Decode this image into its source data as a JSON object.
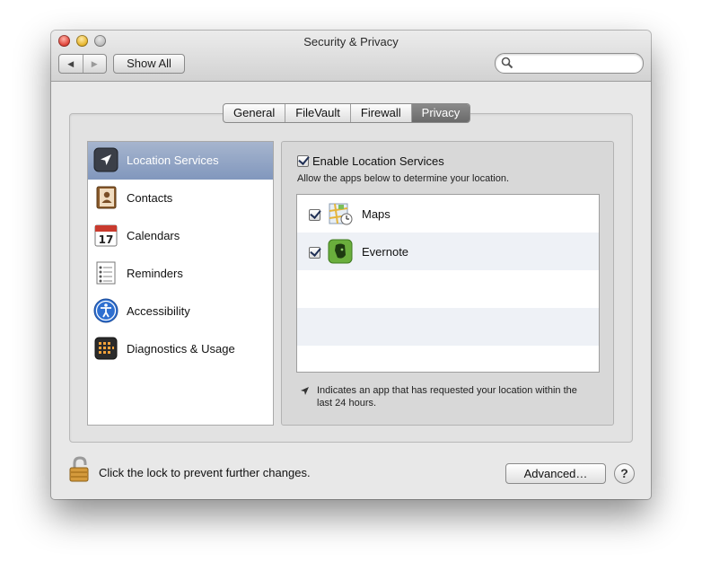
{
  "window": {
    "title": "Security & Privacy"
  },
  "toolbar": {
    "back_icon": "back-arrow-icon",
    "forward_icon": "forward-arrow-icon",
    "show_all_label": "Show All",
    "search": {
      "value": "",
      "placeholder": ""
    }
  },
  "tabs": [
    {
      "label": "General",
      "active": false
    },
    {
      "label": "FileVault",
      "active": false
    },
    {
      "label": "Firewall",
      "active": false
    },
    {
      "label": "Privacy",
      "active": true
    }
  ],
  "sidebar": {
    "items": [
      {
        "label": "Location Services",
        "icon": "location-arrow-icon",
        "selected": true
      },
      {
        "label": "Contacts",
        "icon": "contacts-icon",
        "selected": false
      },
      {
        "label": "Calendars",
        "icon": "calendar-icon",
        "selected": false,
        "icon_text": "17"
      },
      {
        "label": "Reminders",
        "icon": "reminders-icon",
        "selected": false
      },
      {
        "label": "Accessibility",
        "icon": "accessibility-icon",
        "selected": false
      },
      {
        "label": "Diagnostics & Usage",
        "icon": "diagnostics-icon",
        "selected": false
      }
    ]
  },
  "location": {
    "enable_label": "Enable Location Services",
    "enabled": true,
    "description": "Allow the apps below to determine your location.",
    "apps": [
      {
        "name": "Maps",
        "checked": true,
        "icon": "maps-app-icon"
      },
      {
        "name": "Evernote",
        "checked": true,
        "icon": "evernote-app-icon"
      }
    ],
    "note": "Indicates an app that has requested your location within the last 24 hours."
  },
  "footer": {
    "lock_message": "Click the lock to prevent further changes.",
    "advanced_label": "Advanced…",
    "help_label": "?"
  },
  "colors": {
    "selection": "#8fa3c6",
    "active_tab": "#7a7a7a",
    "window_bg": "#e8e8e8"
  }
}
